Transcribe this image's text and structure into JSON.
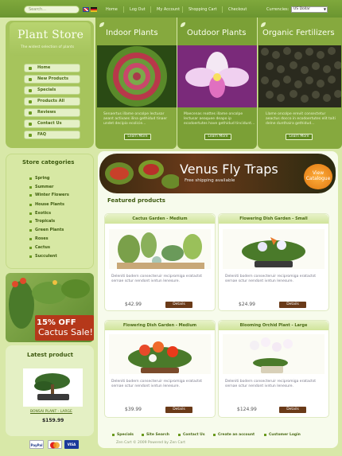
{
  "topbar": {
    "search_placeholder": "Search...",
    "nav": [
      "Home",
      "Log Out",
      "My Account",
      "Shopping Cart",
      "Checkout"
    ],
    "currencies_label": "Currencies:",
    "currency_selected": "US Dollar"
  },
  "logo": {
    "title": "Plant Store",
    "tagline": "The widest selection of plants"
  },
  "menu": [
    "Home",
    "New Products",
    "Specials",
    "Products All",
    "Reviews",
    "Contact Us",
    "FAQ"
  ],
  "categories_top": [
    {
      "title": "Indoor Plants",
      "desc": "Senaertus illame oncolpe lectusar aeant activaes ilina gethidud tinaer undet decipio ecolicie...",
      "button": "Learn More"
    },
    {
      "title": "Outdoor Plants",
      "desc": "Maecenas reattes illame oncolpe lectusar aeaquee deapo ip ecodoertutes have gethidud tincidunt...",
      "button": "Learn More"
    },
    {
      "title": "Organic Fertilizers",
      "desc": "Llame oncolpe erevit consectetur aeactus docco in ecodoertutes elit taiti delne dunthaira gethidud...",
      "button": "Learn More"
    }
  ],
  "store_categories": {
    "title": "Store categories",
    "items": [
      "Spring",
      "Summer",
      "Winter Flowers",
      "House Plants",
      "Exotics",
      "Tropicals",
      "Green Plants",
      "Roses",
      "Cactus",
      "Succulent"
    ]
  },
  "cactus_banner": {
    "line1": "15% OFF",
    "line2": "Cactus Sale!"
  },
  "latest": {
    "title": "Latest product",
    "name": "BONSAI PLANT - LARGE",
    "price": "$159.99"
  },
  "payments": [
    "PayPal",
    "MC",
    "VISA"
  ],
  "venus": {
    "title": "Venus Fly Traps",
    "subtitle": "Free shipping available",
    "button_line1": "View",
    "button_line2": "Catalogue"
  },
  "featured": {
    "title": "Featured products",
    "products": [
      {
        "name": "Cactus Garden - Medium",
        "desc": "Deleniti bodern consecteruir recipromiga eratactst sernae sctur nendont ivntun lenesure.",
        "price": "$42.99",
        "button": "Details"
      },
      {
        "name": "Flowering Dish Garden - Small",
        "desc": "Deleniti bodern consecteruir recipromiga eratactst sernae sctur nendont ivntun lenesure.",
        "price": "$24.99",
        "button": "Details"
      },
      {
        "name": "Flowering Dish Garden - Medium",
        "desc": "Deleniti bodern consecteruir recipromiga eratactst sernae sctur nendont ivntun lenesure.",
        "price": "$39.99",
        "button": "Details"
      },
      {
        "name": "Blooming Orchid Plant - Large",
        "desc": "Deleniti bodern consecteruir recipromiga eratactst sernae sctur nendont ivntun lenesure.",
        "price": "$124.99",
        "button": "Details"
      }
    ]
  },
  "footer": {
    "links": [
      "Specials",
      "Site Search",
      "Contact Us",
      "Create an account",
      "Customer Login"
    ],
    "copyright": "Zen Cart © 2009 Powered by Zen Cart"
  },
  "colors": {
    "accent": "#6b9530",
    "panel": "#a6c45c",
    "button": "#6a3a18"
  }
}
